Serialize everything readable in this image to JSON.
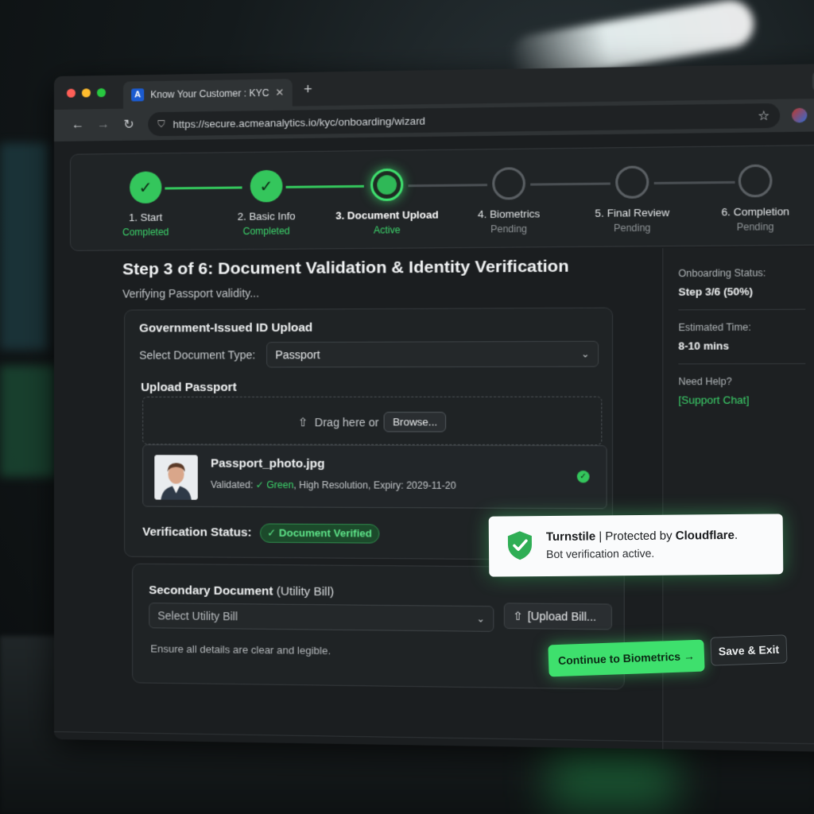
{
  "browser": {
    "tab_title": "Know Your Customer : KYC",
    "tab_logo": "A",
    "url": "https://secure.acmeanalytics.io/kyc/onboarding/wizard"
  },
  "stepper": [
    {
      "label": "1. Start",
      "status": "Completed",
      "state": "done"
    },
    {
      "label": "2. Basic Info",
      "status": "Completed",
      "state": "done"
    },
    {
      "label": "3. Document Upload",
      "status": "Active",
      "state": "active"
    },
    {
      "label": "4. Biometrics",
      "status": "Pending",
      "state": "pending"
    },
    {
      "label": "5. Final Review",
      "status": "Pending",
      "state": "pending"
    },
    {
      "label": "6. Completion",
      "status": "Pending",
      "state": "pending"
    }
  ],
  "main": {
    "title": "Step 3 of 6: Document Validation & Identity Verification",
    "subtitle": "Verifying Passport validity..."
  },
  "gov_id": {
    "heading": "Government-Issued ID Upload",
    "select_label": "Select Document Type:",
    "select_value": "Passport",
    "upload_heading": "Upload Passport",
    "drag_text": "Drag here or",
    "browse_label": "Browse...",
    "file_name": "Passport_photo.jpg",
    "file_meta_prefix": "Validated:",
    "file_meta_green": "✓ Green",
    "file_meta_rest": ", High Resolution, Expiry: 2029-11-20",
    "status_label": "Verification Status:",
    "status_badge": "✓ Document Verified"
  },
  "secondary": {
    "heading": "Secondary Document",
    "heading_suffix": "(Utility Bill)",
    "select_placeholder": "Select Utility Bill",
    "upload_label": "[Upload Bill...",
    "hint": "Ensure all details are clear and legible."
  },
  "sidebar": {
    "status_label": "Onboarding Status:",
    "status_value": "Step 3/6 (50%)",
    "time_label": "Estimated Time:",
    "time_value": "8-10 mins",
    "help_label": "Need Help?",
    "help_link": "[Support Chat]"
  },
  "turnstile": {
    "brand": "Turnstile",
    "protected_by": "| Protected by",
    "provider": "Cloudflare",
    "subtitle": "Bot verification active."
  },
  "footer": {
    "continue_label": "Continue to Biometrics →",
    "save_label": "Save & Exit"
  },
  "colors": {
    "accent": "#3ee06d",
    "background": "#1b1e20"
  }
}
